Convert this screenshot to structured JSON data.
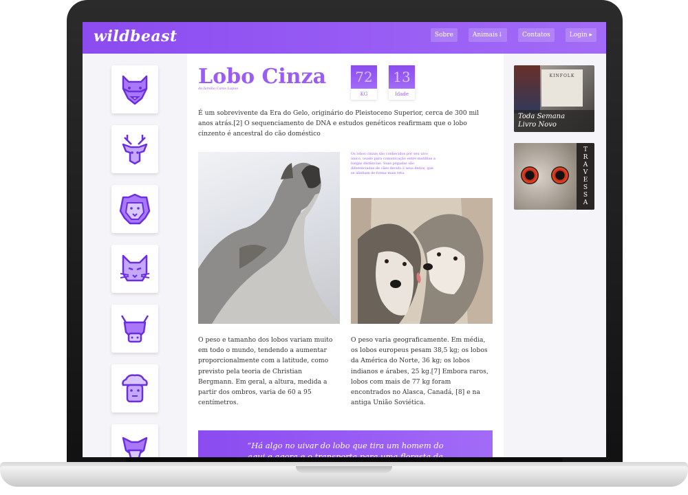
{
  "header": {
    "logo": "wildbeast",
    "nav": [
      "Sobre",
      "Animais↓",
      "Contatos",
      "Login ▸"
    ]
  },
  "sidebar": {
    "icons": [
      "wolf-icon",
      "deer-icon",
      "lion-icon",
      "cat-icon",
      "bull-icon",
      "sheep-icon",
      "dog-icon"
    ]
  },
  "article": {
    "title": "Lobo Cinza",
    "subtitle": "da família Canis Lupus",
    "stats": [
      {
        "value": "72",
        "unit": "KG"
      },
      {
        "value": "13",
        "unit": "Idade"
      }
    ],
    "intro": "É um sobrevivente da Era do Gelo, originário do Pleistoceno Superior, cerca de 300 mil anos atrás.[2] O sequenciamento de DNA e estudos genéticos reafirmam que o lobo cinzento é ancestral do cão doméstico",
    "caption": "Os lobos cinzas são conhecidos por seu uivo único, usado para comunicação entre matilhas a longas distâncias. Suas pegadas são diferenciadas de cães devido à seus dedos, que se alinham de forma mais reta.",
    "col1": "O peso e tamanho dos lobos variam muito em todo o mundo, tendendo a aumentar proporcionalmente com a latitude, como previsto pela teoria de Christian Bergmann. Em geral, a altura, medida a partir dos ombros, varia de 60 a 95 centímetros.",
    "col2": "O peso varia geograficamente. Em média, os lobos europeus pesam 38,5 kg; os lobos da América do Norte, 36 kg; os lobos indianos e árabes, 25 kg.[7] Embora raros, lobos com mais de 77 kg foram encontrados no Alasca, Canadá, [8] e na antiga União Soviética.",
    "quote": "“Há algo no uivar do lobo que tira um homem do aqui e agora e o transporta para uma floresta da mente.”"
  },
  "ads": {
    "ad1_brand": "KINFOLK",
    "ad1_caption_1": "Toda Semana",
    "ad1_caption_2": "Livro Novo",
    "ad2_letters": [
      "T",
      "R",
      "A",
      "V",
      "E",
      "S",
      "S",
      "A"
    ]
  },
  "colors": {
    "accent": "#9b5cf4",
    "header_start": "#8b4bf0",
    "header_end": "#a26bf7"
  }
}
